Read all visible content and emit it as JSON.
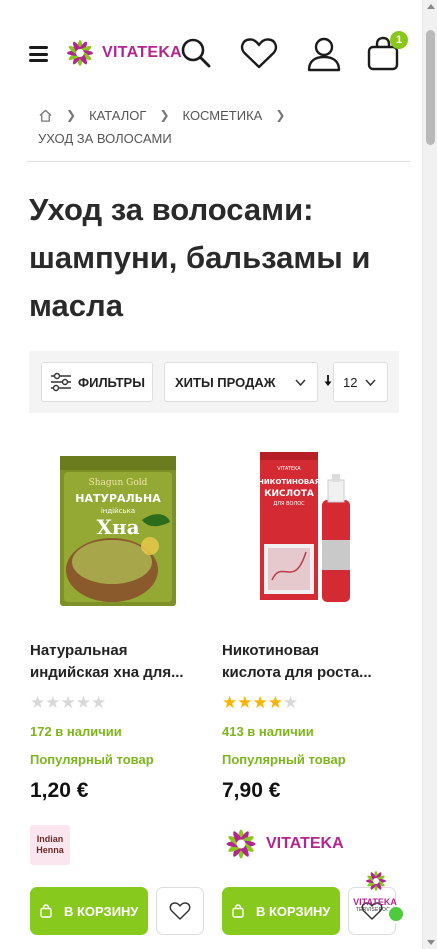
{
  "header": {
    "logo_text": "VITATEKA",
    "cart_count": "1"
  },
  "breadcrumb": {
    "items": [
      "КАТАЛОГ",
      "КОСМЕТИКА",
      "УХОД ЗА ВОЛОСАМИ"
    ]
  },
  "page": {
    "title": "Уход за волосами: шампуни, бальзамы и масла"
  },
  "toolbar": {
    "filter_label": "ФИЛЬТРЫ",
    "sort_value": "ХИТЫ ПРОДАЖ",
    "per_page_value": "12"
  },
  "colors": {
    "brand": "#b3268f",
    "accent_green": "#88c91e",
    "stock_green": "#7db51d",
    "star_gold": "#f7b500"
  },
  "products": [
    {
      "name_line1": "Натуральная",
      "name_line2": "индийская хна для...",
      "rating": 0,
      "rating_max": 5,
      "stock": "172 в наличии",
      "badge": "Популярный товар",
      "price": "1,20 €",
      "brand_line1": "Indian",
      "brand_line2": "Henna",
      "pack_brand": "Shagun Gold",
      "pack_line1": "НАТУРАЛЬНА",
      "pack_line2": "індійська",
      "pack_line3": "Хна",
      "buy_label": "В КОРЗИНУ"
    },
    {
      "name_line1": "Никотиновая",
      "name_line2": "кислота для роста...",
      "rating": 4,
      "rating_max": 5,
      "stock": "413 в наличии",
      "badge": "Популярный товар",
      "price": "7,90 €",
      "brand_name": "VITATEKA",
      "pack_line1": "НИКОТИНОВАЯ",
      "pack_line2": "КИСЛОТА",
      "pack_line3": "ДЛЯ ВОЛОС",
      "buy_label": "В КОРЗИНУ"
    }
  ],
  "chat_widget": {
    "name": "VITATEKA",
    "sub": "TERVISEPOOD"
  }
}
